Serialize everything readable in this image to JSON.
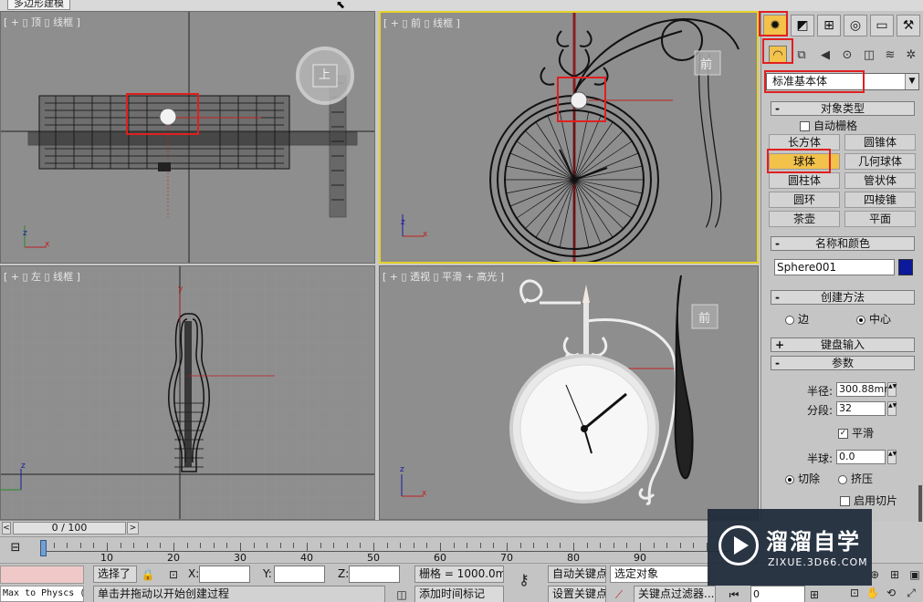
{
  "window": {
    "tab_title": "多边形建模"
  },
  "viewports": {
    "top": {
      "label": "[ + ▯ 顶 ▯ 线框 ]",
      "cube_label": "上"
    },
    "front": {
      "label": "[ + ▯ 前 ▯ 线框 ]",
      "cube_label": "前"
    },
    "left": {
      "label": "[ + ▯ 左 ▯ 线框 ]"
    },
    "persp": {
      "label": "[ + ▯ 透视 ▯ 平滑 + 高光 ]",
      "cube_label": "前"
    },
    "axis_z": "z",
    "axis_x": "x",
    "axis_y": "y"
  },
  "command_panel": {
    "primitive_dropdown": "标准基本体",
    "object_type": {
      "header": "对象类型",
      "auto_grid": "自动栅格",
      "buttons": [
        "长方体",
        "圆锥体",
        "球体",
        "几何球体",
        "圆柱体",
        "管状体",
        "圆环",
        "四棱锥",
        "茶壶",
        "平面"
      ],
      "active": "球体"
    },
    "name_color": {
      "header": "名称和颜色",
      "name": "Sphere001",
      "color": "#0a1a9a"
    },
    "creation_method": {
      "header": "创建方法",
      "edge": "边",
      "center": "中心",
      "selected": "中心"
    },
    "keyboard_entry": {
      "header": "键盘输入"
    },
    "parameters": {
      "header": "参数",
      "radius_label": "半径:",
      "radius": "300.88mm",
      "segments_label": "分段:",
      "segments": "32",
      "smooth_label": "平滑",
      "smooth": true,
      "hemisphere_label": "半球:",
      "hemisphere": "0.0",
      "chop_label": "切除",
      "squash_label": "挤压",
      "mode": "切除",
      "slice_on_label": "启用切片"
    },
    "panel_signs": {
      "collapse": "-",
      "expand": "+"
    }
  },
  "timeline": {
    "frame_counter": "0 / 100",
    "prev": "<",
    "next": ">",
    "ticks": [
      "10",
      "20",
      "30",
      "40",
      "50",
      "60",
      "70",
      "80",
      "90"
    ],
    "current_frame": 0
  },
  "status": {
    "max_script": "Max to Physcs (",
    "selection": "选择了",
    "x_label": "X:",
    "y_label": "Y:",
    "z_label": "Z:",
    "grid": "栅格 = 1000.0mm",
    "prompt": "单击并拖动以开始创建过程",
    "add_time_tag": "添加时间标记",
    "auto_key": "自动关键点",
    "set_key": "设置关键点",
    "selected_object": "选定对象",
    "key_filters": "关键点过滤器...",
    "frame_field": "0"
  },
  "watermark": {
    "title": "溜溜自学",
    "subtitle": "ZIXUE.3D66.COM"
  }
}
